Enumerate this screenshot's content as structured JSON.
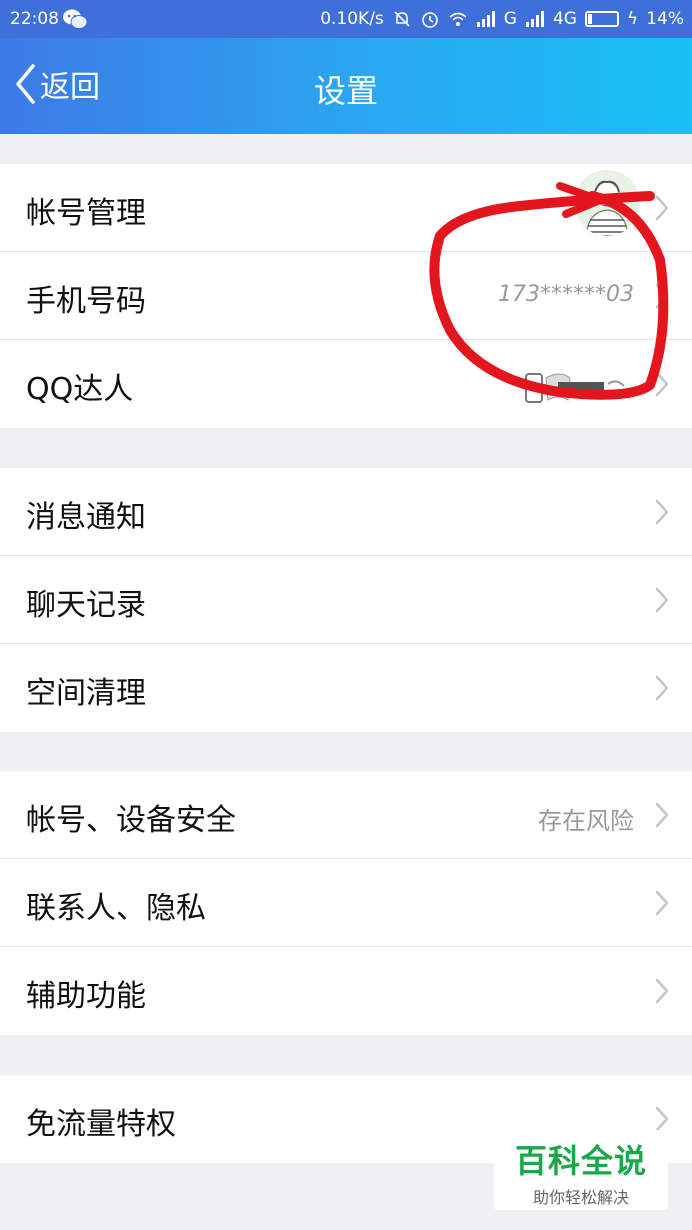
{
  "status_bar": {
    "time": "22:08",
    "net_speed": "0.10K/s",
    "signal_label_1": "G",
    "signal_label_2": "4G",
    "battery_percent": "14%",
    "battery_level": 0.14,
    "icons": [
      "wechat-icon",
      "mute-bell-icon",
      "alarm-clock-icon",
      "wifi-icon",
      "signal-icon",
      "battery-icon",
      "charging-icon"
    ]
  },
  "navbar": {
    "back_label": "返回",
    "title": "设置"
  },
  "groups": [
    {
      "items": [
        {
          "label": "帐号管理",
          "trailing": "avatar"
        },
        {
          "label": "手机号码",
          "value": "173******03"
        },
        {
          "label": "QQ达人",
          "trailing": "badge"
        }
      ]
    },
    {
      "items": [
        {
          "label": "消息通知"
        },
        {
          "label": "聊天记录"
        },
        {
          "label": "空间清理"
        }
      ]
    },
    {
      "items": [
        {
          "label": "帐号、设备安全",
          "value": "存在风险"
        },
        {
          "label": "联系人、隐私"
        },
        {
          "label": "辅助功能"
        }
      ]
    },
    {
      "items": [
        {
          "label": "免流量特权"
        }
      ]
    }
  ],
  "watermark": {
    "brand": "百科全说",
    "slogan": "助你轻松解决"
  },
  "colors": {
    "nav_start": "#3d7ae6",
    "nav_end": "#18c0f6",
    "annotation": "#e3161d",
    "watermark_green": "#1aa84a"
  }
}
